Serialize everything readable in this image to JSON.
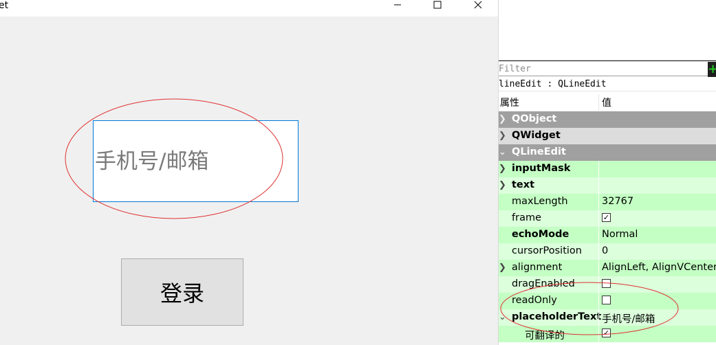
{
  "window": {
    "title": "et",
    "minimize_icon": "minimize-icon",
    "maximize_icon": "maximize-icon",
    "close_icon": "close-icon"
  },
  "form": {
    "account_placeholder": "手机号/邮箱",
    "account_value": "",
    "login_label": "登录"
  },
  "property_editor": {
    "filter_placeholder": "Filter",
    "filter_value": "",
    "add_icon": "plus-icon",
    "object_line": "lineEdit : QLineEdit",
    "header": {
      "name": "属性",
      "value": "值"
    },
    "groups": {
      "qobject": "QObject",
      "qwidget": "QWidget",
      "qlineedit": "QLineEdit"
    },
    "properties": {
      "inputMask": {
        "name": "inputMask",
        "value": ""
      },
      "text": {
        "name": "text",
        "value": ""
      },
      "maxLength": {
        "name": "maxLength",
        "value": "32767"
      },
      "frame": {
        "name": "frame",
        "checked": true
      },
      "echoMode": {
        "name": "echoMode",
        "value": "Normal"
      },
      "cursorPosition": {
        "name": "cursorPosition",
        "value": "0"
      },
      "alignment": {
        "name": "alignment",
        "value": "AlignLeft, AlignVCenter"
      },
      "dragEnabled": {
        "name": "dragEnabled",
        "checked": false
      },
      "readOnly": {
        "name": "readOnly",
        "checked": false
      },
      "placeholderText": {
        "name": "placeholderText",
        "value": "手机号/邮箱"
      },
      "translatable": {
        "name": "可翻译的",
        "checked": true
      }
    }
  },
  "colors": {
    "annotation": "#e03030",
    "focus_border": "#0078d7",
    "group_header": "#a0a0a0",
    "row_green_dark": "#c4ffc4",
    "row_green_light": "#dcffdc"
  }
}
